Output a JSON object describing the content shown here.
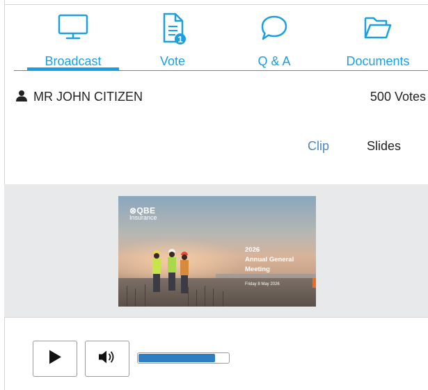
{
  "tabs": [
    {
      "label": "Broadcast",
      "icon": "monitor-icon",
      "active": true
    },
    {
      "label": "Vote",
      "icon": "document-icon",
      "badge": "1"
    },
    {
      "label": "Q & A",
      "icon": "speech-bubble-icon"
    },
    {
      "label": "Documents",
      "icon": "folder-icon"
    }
  ],
  "user": {
    "name": "MR JOHN CITIZEN",
    "votes": "500 Votes",
    "icon": "person-icon"
  },
  "view": {
    "clip_label": "Clip",
    "slides_label": "Slides"
  },
  "slide": {
    "logo": "⊗QBE",
    "logo_sub": "Insurance",
    "line1": "2026",
    "line2": "Annual General",
    "line3": "Meeting",
    "date": "Friday 8 May 2026"
  },
  "player": {
    "volume": 0.85
  },
  "colors": {
    "accent": "#1a9fe0",
    "clip_link": "#4a86c6",
    "volume_fill": "#2f7ec3",
    "badge": "#1a9fe0"
  }
}
